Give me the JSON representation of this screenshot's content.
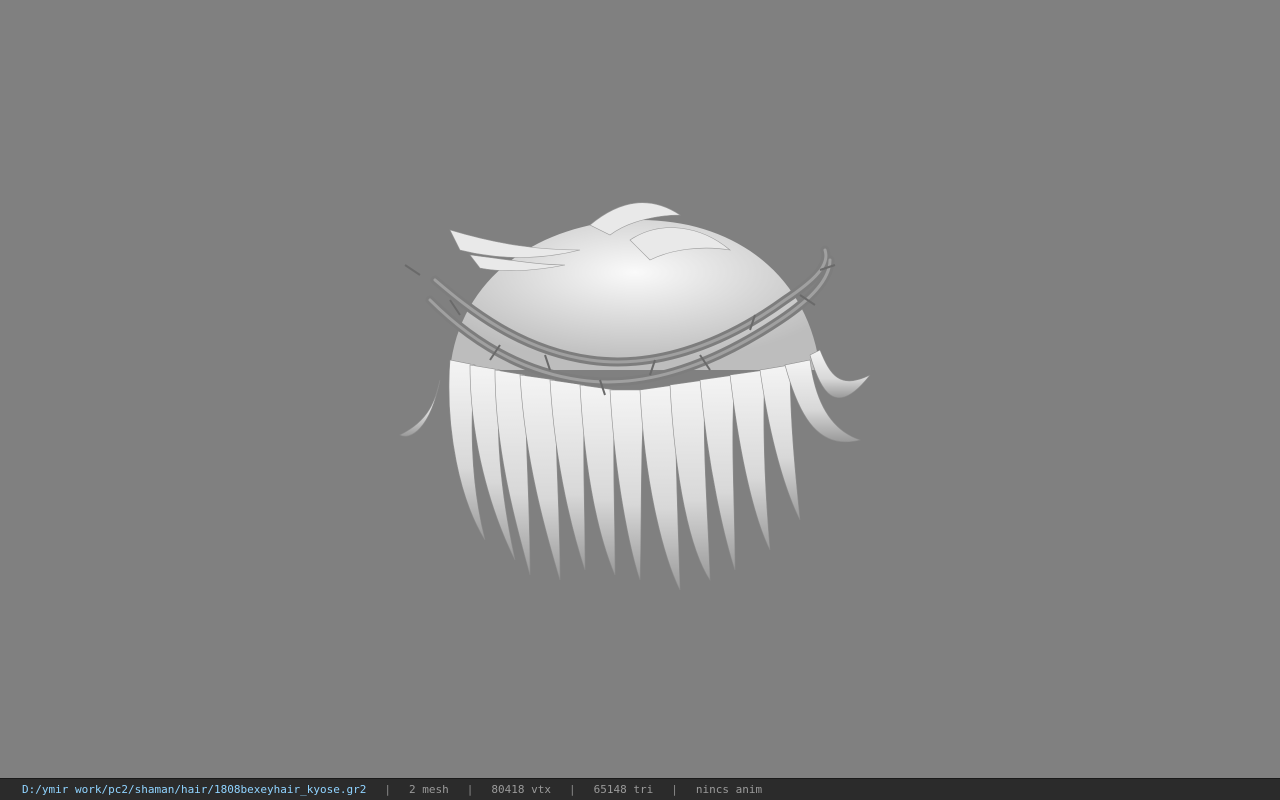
{
  "viewport": {
    "background": "#808080",
    "model": {
      "icon": "hair-model-icon",
      "hair_color": "#e6e6e6",
      "crown_color": "#8a8a8a"
    }
  },
  "statusbar": {
    "file_path": "D:/ymir work/pc2/shaman/hair/1808bexeyhair_kyose.gr2",
    "separator": "|",
    "mesh_count": "2 mesh",
    "vertex_count": "80418 vtx",
    "triangle_count": "65148 tri",
    "animation": "nincs anim",
    "path_color": "#8fd3ff"
  }
}
